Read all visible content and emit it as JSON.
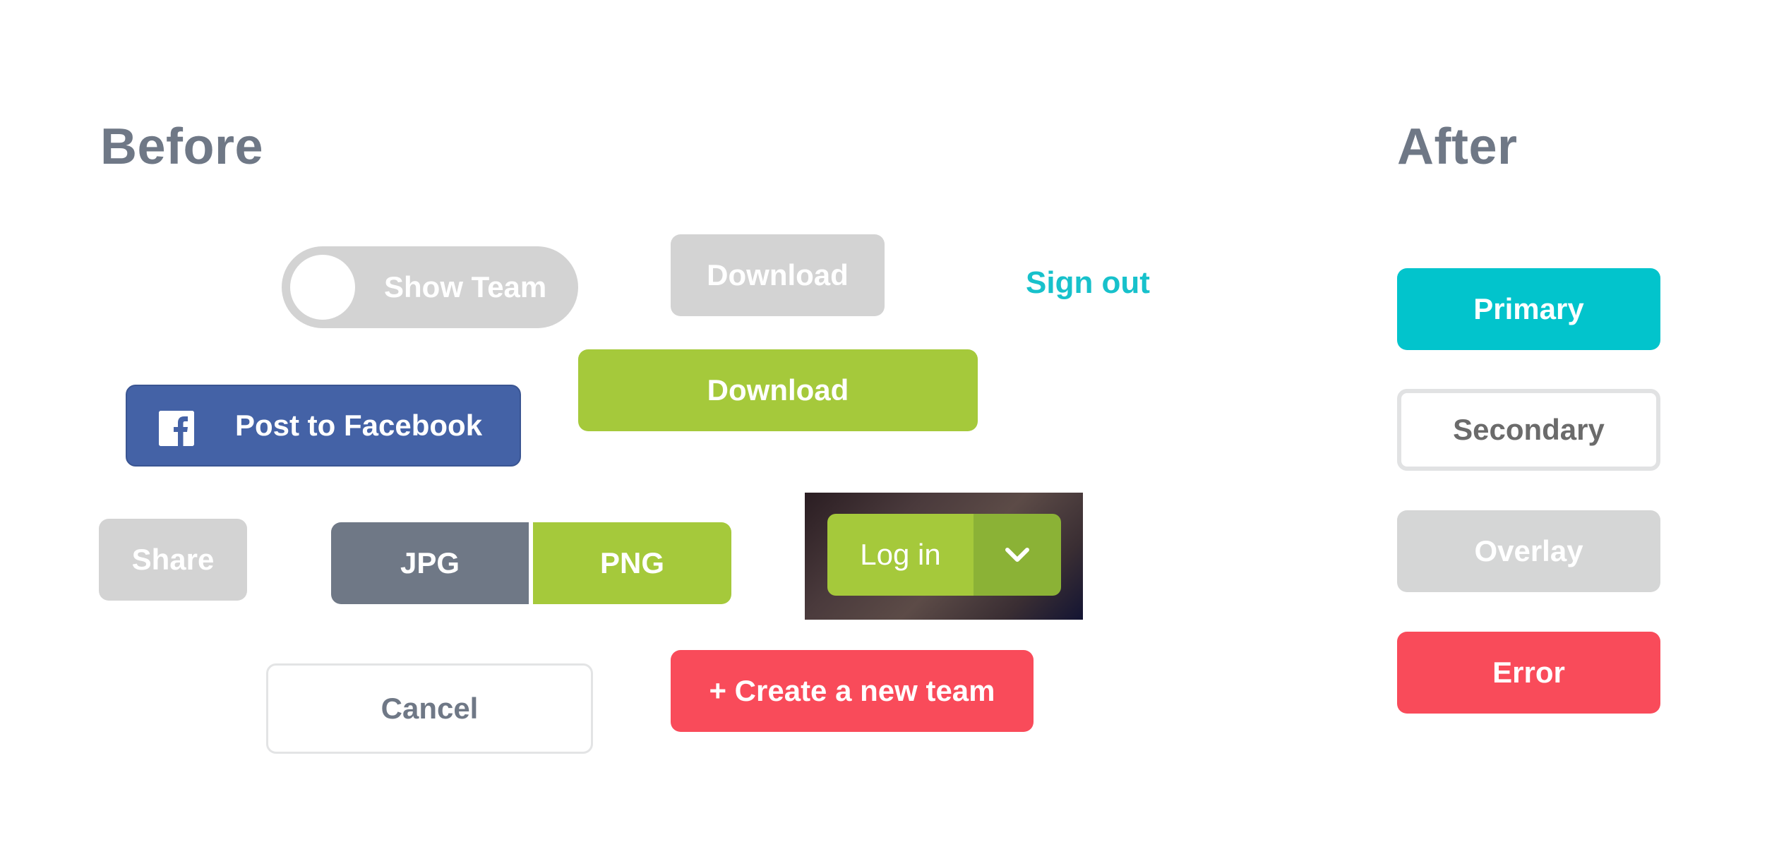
{
  "before": {
    "title": "Before",
    "toggle": {
      "label": "Show Team"
    },
    "download_gray": {
      "label": "Download"
    },
    "sign_out": {
      "label": "Sign out"
    },
    "download_green": {
      "label": "Download"
    },
    "facebook": {
      "label": "Post to Facebook",
      "icon": "facebook-icon"
    },
    "share": {
      "label": "Share"
    },
    "format_group": {
      "jpg": "JPG",
      "png": "PNG"
    },
    "login": {
      "label": "Log in",
      "dropdown_icon": "chevron-down-icon"
    },
    "cancel": {
      "label": "Cancel"
    },
    "create_team": {
      "label": "+ Create a new team"
    }
  },
  "after": {
    "title": "After",
    "primary": {
      "label": "Primary"
    },
    "secondary": {
      "label": "Secondary"
    },
    "overlay": {
      "label": "Overlay"
    },
    "error": {
      "label": "Error"
    }
  },
  "colors": {
    "heading": "#6f7886",
    "gray": "#d3d3d3",
    "green": "#a5c93b",
    "green_dark": "#8bb236",
    "facebook_blue": "#4462a6",
    "slate": "#6f7886",
    "red": "#f94b5a",
    "teal": "#02c4cc",
    "link_teal": "#17c1cb"
  }
}
